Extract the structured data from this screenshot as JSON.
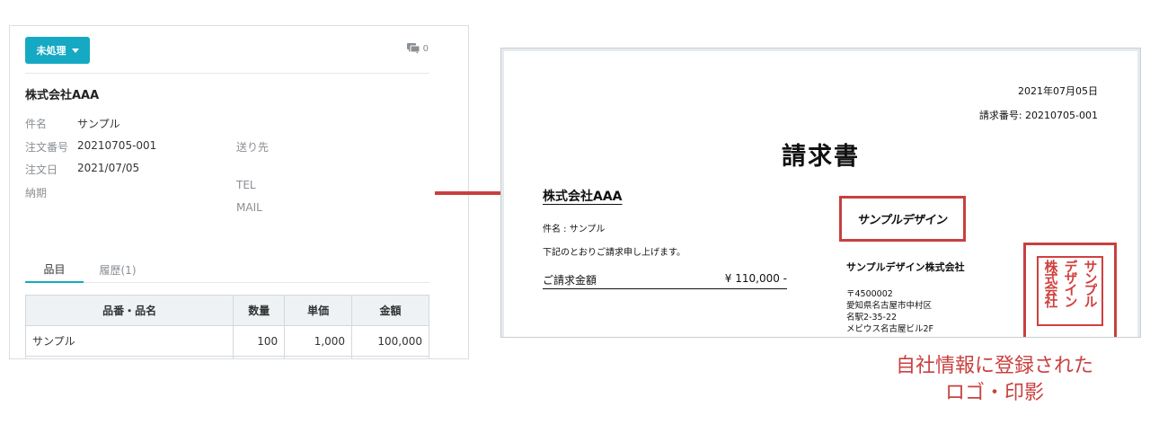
{
  "order": {
    "status_label": "未処理",
    "comment_count": "0",
    "company": "株式会社AAA",
    "fields": [
      {
        "label": "件名",
        "value": "サンプル"
      },
      {
        "label": "注文番号",
        "value": "20210705-001"
      },
      {
        "label": "注文日",
        "value": "2021/07/05"
      },
      {
        "label": "納期",
        "value": ""
      }
    ],
    "side_fields": [
      "送り先",
      "TEL",
      "MAIL"
    ],
    "tabs": [
      {
        "label": "品目",
        "active": true
      },
      {
        "label": "履歴(1)",
        "active": false
      }
    ],
    "table": {
      "headers": [
        "品番・品名",
        "数量",
        "単価",
        "金額"
      ],
      "rows": [
        [
          "サンプル",
          "100",
          "1,000",
          "100,000"
        ]
      ]
    }
  },
  "invoice": {
    "date": "2021年07月05日",
    "number": "請求番号: 20210705-001",
    "title": "請求書",
    "to": "株式会社AAA",
    "subject": "件名 : サンプル",
    "lead": "下記のとおりご請求申し上げます。",
    "amount_label": "ご請求金額",
    "amount_value": "¥ 110,000 -",
    "logo_text": "サンプルデザイン",
    "company_name": "サンプルデザイン株式会社",
    "address_lines": [
      "〒4500002",
      "愛知県名古屋市中村区",
      "名駅2-35-22",
      "メビウス名古屋ビル2F"
    ],
    "seal_columns": [
      "サンプル",
      "デザイン",
      "株式会社"
    ]
  },
  "caption_lines": [
    "自社情報に登録された",
    "ロゴ・印影"
  ],
  "colors": {
    "accent": "#15a9c3",
    "highlight": "#c7403f"
  }
}
